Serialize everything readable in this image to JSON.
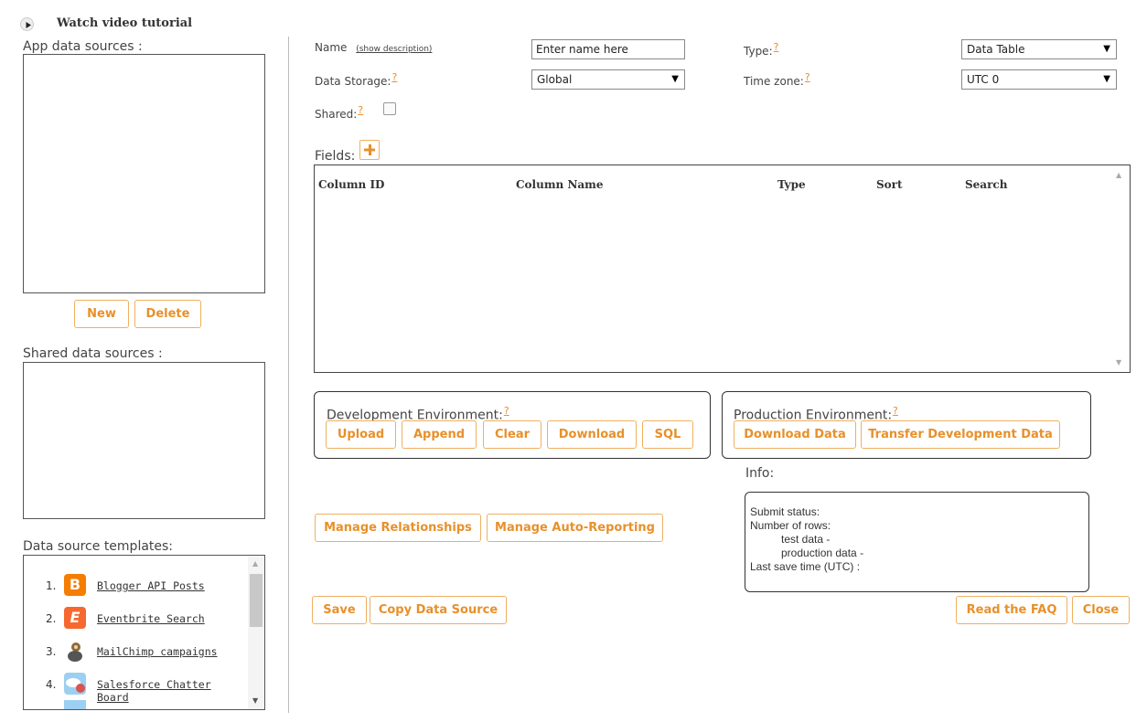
{
  "top": {
    "tutorial_label": "Watch video tutorial"
  },
  "left": {
    "app_sources_label": "App data sources :",
    "new_label": "New",
    "delete_label": "Delete",
    "shared_sources_label": "Shared data sources :",
    "templates_label": "Data source templates:",
    "templates": [
      {
        "num": "1.",
        "name": "Blogger API Posts",
        "icon": "blogger-icon",
        "color": "#f57d00"
      },
      {
        "num": "2.",
        "name": "Eventbrite Search",
        "icon": "eventbrite-icon",
        "color": "#f6682f"
      },
      {
        "num": "3.",
        "name": "MailChimp campaigns",
        "icon": "mailchimp-icon",
        "color": "#8a6d3b"
      },
      {
        "num": "4.",
        "name": "Salesforce Chatter Board",
        "icon": "salesforce-icon",
        "color": "#5aa9e6"
      }
    ]
  },
  "form": {
    "name_label": "Name",
    "show_description": "(show description)",
    "name_placeholder": "Enter name here",
    "type_label": "Type:",
    "type_value": "Data Table",
    "storage_label": "Data Storage:",
    "storage_value": "Global",
    "timezone_label": "Time zone:",
    "timezone_value": "UTC 0",
    "shared_label": "Shared:",
    "help_mark": "?"
  },
  "fields": {
    "label": "Fields:",
    "columns": [
      "Column ID",
      "Column Name",
      "Type",
      "Sort",
      "Search"
    ]
  },
  "dev_env": {
    "title": "Development Environment:",
    "buttons": [
      "Upload",
      "Append",
      "Clear",
      "Download",
      "SQL"
    ]
  },
  "prod_env": {
    "title": "Production Environment:",
    "buttons": [
      "Download Data",
      "Transfer Development Data"
    ]
  },
  "info": {
    "label": "Info:",
    "submit_status": "Submit status:",
    "num_rows": "Number of rows:",
    "test_data": "test data -",
    "production_data": "production data -",
    "last_save": "Last save time (UTC) :"
  },
  "actions": {
    "manage_relationships": "Manage Relationships",
    "manage_auto_reporting": "Manage Auto-Reporting",
    "save": "Save",
    "copy": "Copy Data Source",
    "faq": "Read the FAQ",
    "close": "Close"
  },
  "colors": {
    "accent": "#e8902a",
    "button_border": "#f0b060"
  }
}
